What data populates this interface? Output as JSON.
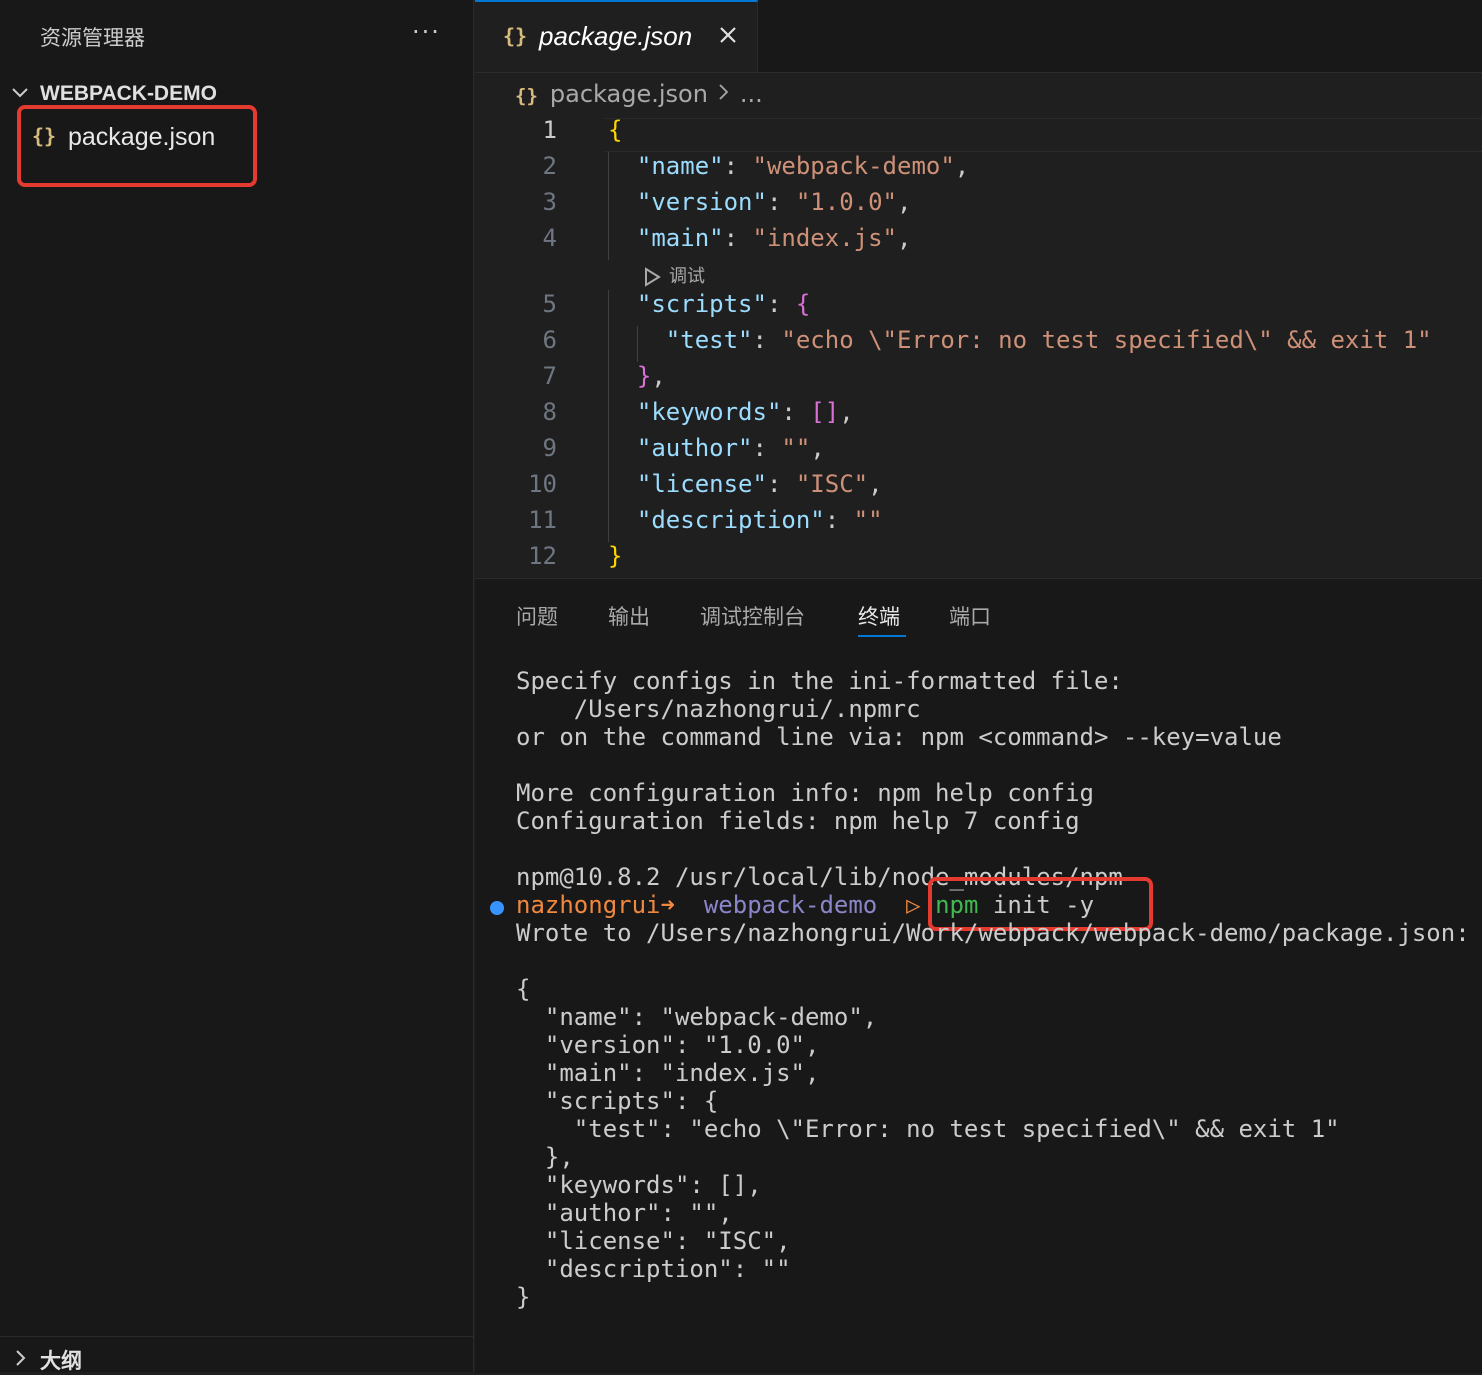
{
  "sidebar": {
    "title": "资源管理器",
    "more": "···",
    "project": "WEBPACK-DEMO",
    "file": "package.json",
    "outline": "大纲"
  },
  "editor": {
    "tab_label": "package.json",
    "breadcrumb_file": "package.json",
    "breadcrumb_more": "...",
    "codelens": "调试",
    "lines": [
      {
        "n": "1",
        "parts": [
          [
            "b1",
            "{"
          ]
        ]
      },
      {
        "n": "2",
        "parts": [
          [
            "k",
            "  \"name\""
          ],
          [
            "p",
            ": "
          ],
          [
            "s",
            "\"webpack-demo\""
          ],
          [
            "p",
            ","
          ]
        ]
      },
      {
        "n": "3",
        "parts": [
          [
            "k",
            "  \"version\""
          ],
          [
            "p",
            ": "
          ],
          [
            "s",
            "\"1.0.0\""
          ],
          [
            "p",
            ","
          ]
        ]
      },
      {
        "n": "4",
        "parts": [
          [
            "k",
            "  \"main\""
          ],
          [
            "p",
            ": "
          ],
          [
            "s",
            "\"index.js\""
          ],
          [
            "p",
            ","
          ]
        ]
      },
      {
        "n": "5",
        "parts": [
          [
            "k",
            "  \"scripts\""
          ],
          [
            "p",
            ": "
          ],
          [
            "b2",
            "{"
          ]
        ]
      },
      {
        "n": "6",
        "parts": [
          [
            "k",
            "    \"test\""
          ],
          [
            "p",
            ": "
          ],
          [
            "s",
            "\"echo \\\"Error: no test specified\\\" && exit 1\""
          ]
        ]
      },
      {
        "n": "7",
        "parts": [
          [
            "b2",
            "  }"
          ],
          [
            "p",
            ","
          ]
        ]
      },
      {
        "n": "8",
        "parts": [
          [
            "k",
            "  \"keywords\""
          ],
          [
            "p",
            ": "
          ],
          [
            "b2",
            "[]"
          ],
          [
            "p",
            ","
          ]
        ]
      },
      {
        "n": "9",
        "parts": [
          [
            "k",
            "  \"author\""
          ],
          [
            "p",
            ": "
          ],
          [
            "s",
            "\"\""
          ],
          [
            "p",
            ","
          ]
        ]
      },
      {
        "n": "10",
        "parts": [
          [
            "k",
            "  \"license\""
          ],
          [
            "p",
            ": "
          ],
          [
            "s",
            "\"ISC\""
          ],
          [
            "p",
            ","
          ]
        ]
      },
      {
        "n": "11",
        "parts": [
          [
            "k",
            "  \"description\""
          ],
          [
            "p",
            ": "
          ],
          [
            "s",
            "\"\""
          ]
        ]
      },
      {
        "n": "12",
        "parts": [
          [
            "b1",
            "}"
          ]
        ]
      }
    ]
  },
  "panel": {
    "tabs": [
      "问题",
      "输出",
      "调试控制台",
      "终端",
      "端口"
    ],
    "active_tab": "终端",
    "terminal_before": [
      "Specify configs in the ini-formatted file:",
      "    /Users/nazhongrui/.npmrc",
      "or on the command line via: npm <command> --key=value",
      "",
      "More configuration info: npm help config",
      "Configuration fields: npm help 7 config",
      "",
      "npm@10.8.2 /usr/local/lib/node_modules/npm"
    ],
    "prompt": {
      "user": "nazhongrui",
      "arrow": "➜",
      "dir": "webpack-demo",
      "symbol": "▷",
      "cmd_name": "npm",
      "cmd_args": " init -y"
    },
    "terminal_after": [
      "Wrote to /Users/nazhongrui/Work/webpack/webpack-demo/package.json:",
      "",
      "{",
      "  \"name\": \"webpack-demo\",",
      "  \"version\": \"1.0.0\",",
      "  \"main\": \"index.js\",",
      "  \"scripts\": {",
      "    \"test\": \"echo \\\"Error: no test specified\\\" && exit 1\"",
      "  },",
      "  \"keywords\": [],",
      "  \"author\": \"\",",
      "  \"license\": \"ISC\",",
      "  \"description\": \"\"",
      "}"
    ]
  },
  "colors": {
    "highlight": "#e53a2f",
    "accent": "#0078d4",
    "json_icon": "#d7ba7d"
  }
}
